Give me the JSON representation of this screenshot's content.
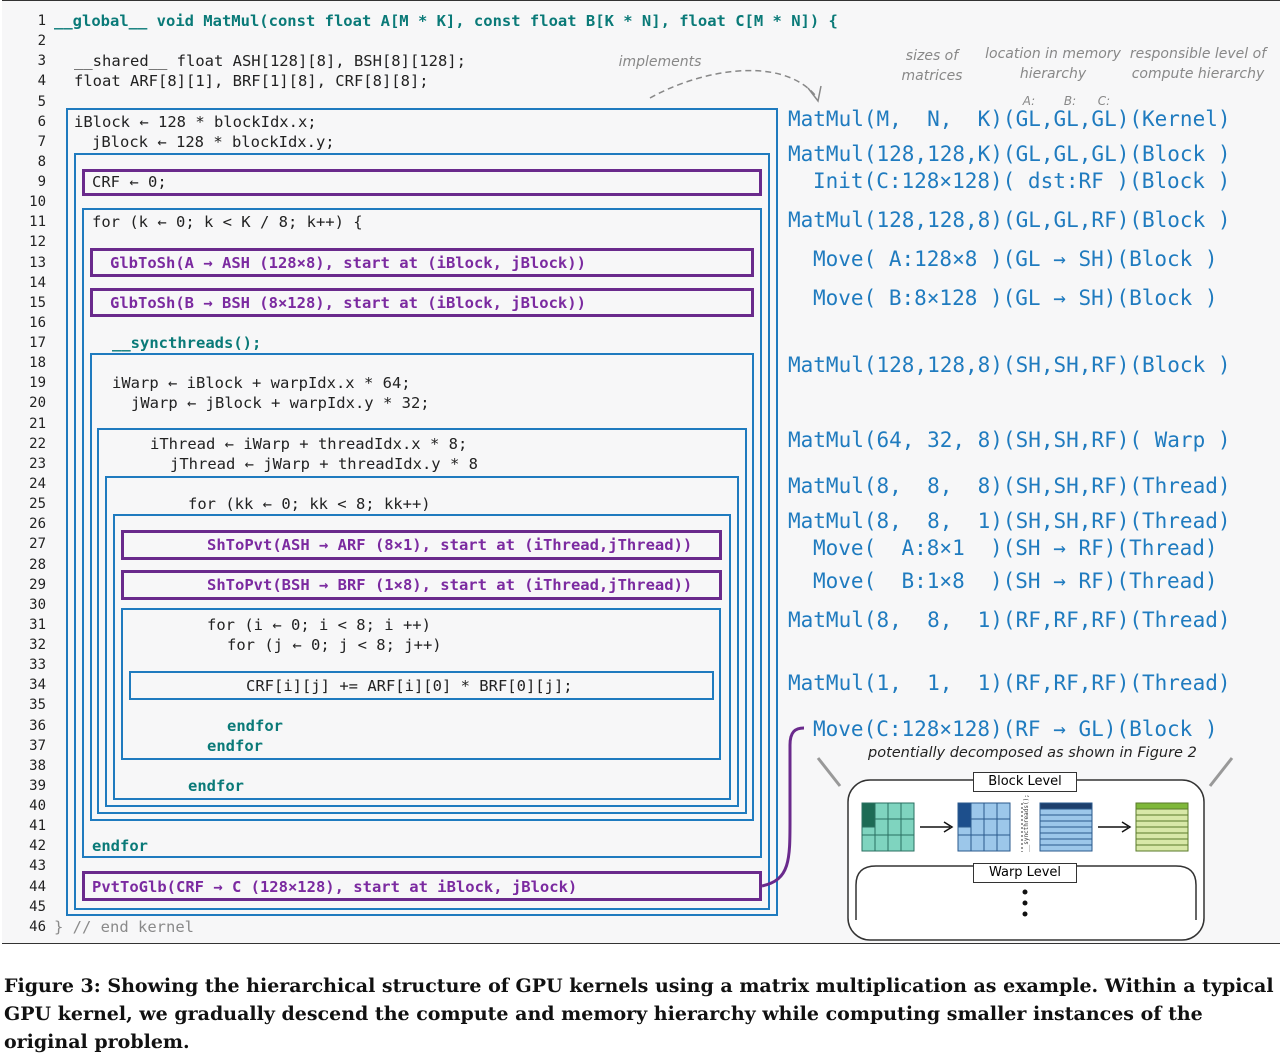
{
  "code_lines": [
    "__global__ void MatMul(const float A[M * K], const float B[K * N], float C[M * N]) {",
    "",
    "__shared__ float ASH[128][8], BSH[8][128];",
    "float ARF[8][1], BRF[1][8], CRF[8][8];",
    "",
    "iBlock ← 128 * blockIdx.x;",
    "jBlock ← 128 * blockIdx.y;",
    "",
    "CRF ← 0;",
    "",
    "for (k ← 0; k < K / 8; k++) {",
    "",
    "GlbToSh(A → ASH (128×8), start at (iBlock, jBlock))",
    "",
    "GlbToSh(B → BSH (8×128), start at (iBlock, jBlock))",
    "",
    "__syncthreads();",
    "",
    "iWarp ← iBlock + warpIdx.x * 64;",
    "jWarp ← jBlock + warpIdx.y * 32;",
    "",
    "iThread ← iWarp + threadIdx.x * 8;",
    "jThread ← jWarp + threadIdx.y * 8",
    "",
    "for (kk ← 0; kk < 8; kk++)",
    "",
    "ShToPvt(ASH → ARF (8×1), start at (iThread,jThread))",
    "",
    "ShToPvt(BSH → BRF (1×8), start at (iThread,jThread))",
    "",
    "for (i ← 0; i < 8; i ++)",
    "for (j ← 0; j < 8; j++)",
    "",
    "CRF[i][j] += ARF[i][0] * BRF[0][j];",
    "",
    "endfor",
    "endfor",
    "",
    "endfor",
    "",
    "",
    "endfor",
    "",
    "PvtToGlb(CRF → C (128×128), start at iBlock, jBlock)",
    "",
    "} // end kernel"
  ],
  "header": {
    "implements": "implements",
    "sizes": "sizes of matrices",
    "location": "location in memory hierarchy",
    "responsible": "responsible level of compute hierarchy",
    "abc": [
      "A:",
      "B:",
      "C:"
    ]
  },
  "right_lines": [
    "MatMul(M,  N,  K)(GL,GL,GL)(Kernel)",
    "MatMul(128,128,K)(GL,GL,GL)(Block )",
    "Init(C:128×128)( dst:RF )(Block )",
    "MatMul(128,128,8)(GL,GL,RF)(Block )",
    "Move( A:128×8 )(GL → SH)(Block )",
    "Move( B:8×128 )(GL → SH)(Block )",
    "MatMul(128,128,8)(SH,SH,RF)(Block )",
    "MatMul(64, 32, 8)(SH,SH,RF)( Warp )",
    "MatMul(8,  8,  8)(SH,SH,RF)(Thread)",
    "MatMul(8,  8,  1)(SH,SH,RF)(Thread)",
    "Move(  A:8×1  )(SH → RF)(Thread)",
    "Move(  B:1×8  )(SH → RF)(Thread)",
    "MatMul(8,  8,  1)(RF,RF,RF)(Thread)",
    "MatMul(1,  1,  1)(RF,RF,RF)(Thread)",
    "Move(C:128×128)(RF → GL)(Block )"
  ],
  "decomposed_note": "potentially decomposed as shown in Figure 2",
  "block_level": "Block Level",
  "warp_level": "Warp Level",
  "sync_label": "__syncthreads();",
  "caption": "Figure 3: Showing the hierarchical structure of GPU kernels using a matrix multiplication as example. Within a typical GPU kernel, we gradually descend the compute and memory hierarchy while computing smaller instances of the original problem.",
  "colors": {
    "blue": "#1f7bbf",
    "purple": "#6a2a8c",
    "teal": "#0a7a78"
  }
}
